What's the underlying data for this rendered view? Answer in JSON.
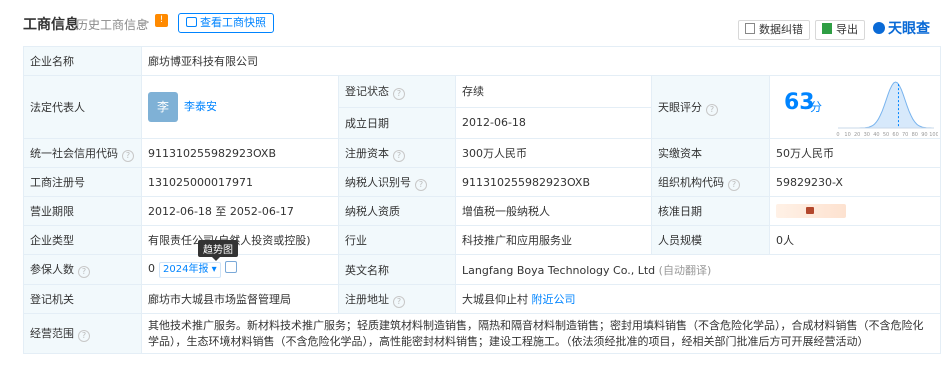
{
  "header": {
    "title": "工商信息",
    "history_link": "历史工商信息",
    "history_arrow": ">",
    "snapshot_button": "查看工商快照",
    "error_button": "数据纠错",
    "export_button": "导出",
    "logo_text": "天眼查"
  },
  "rows": {
    "company_name_label": "企业名称",
    "company_name": "廊坊博亚科技有限公司",
    "legal_rep_label": "法定代表人",
    "legal_rep_avatar": "李",
    "legal_rep_name": "李泰安",
    "reg_status_label": "登记状态",
    "reg_status": "存续",
    "found_date_label": "成立日期",
    "found_date": "2012-06-18",
    "score_label": "天眼评分",
    "score_value": "63",
    "score_unit": "分",
    "credit_code_label": "统一社会信用代码",
    "credit_code": "911310255982923OXB",
    "reg_capital_label": "注册资本",
    "reg_capital": "300万人民币",
    "paid_capital_label": "实缴资本",
    "paid_capital": "50万人民币",
    "reg_no_label": "工商注册号",
    "reg_no": "131025000017971",
    "taxpayer_id_label": "纳税人识别号",
    "taxpayer_id": "911310255982923OXB",
    "org_code_label": "组织机构代码",
    "org_code": "59829230-X",
    "term_label": "营业期限",
    "term": "2012-06-18 至 2052-06-17",
    "tax_qual_label": "纳税人资质",
    "tax_qual": "增值税一般纳税人",
    "approve_date_label": "核准日期",
    "type_label": "企业类型",
    "type_value": "有限责任公司(自然人投资或控股)",
    "industry_label": "行业",
    "industry": "科技推广和应用服务业",
    "staff_size_label": "人员规模",
    "staff_size": "0人",
    "insured_label": "参保人数",
    "insured_count": "0",
    "insured_year": "2024年报",
    "insured_tooltip": "趋势图",
    "english_name_label": "英文名称",
    "english_name": "Langfang Boya Technology Co., Ltd",
    "english_name_note": "(自动翻译)",
    "authority_label": "登记机关",
    "authority": "廊坊市大城县市场监督管理局",
    "address_label": "注册地址",
    "address": "大城县仰止村",
    "nearby_link": "附近公司",
    "scope_label": "经营范围",
    "scope": "其他技术推广服务。新材料技术推广服务；轻质建筑材料制造销售，隔热和隔音材料制造销售；密封用填料销售（不含危险化学品），合成材料销售（不含危险化学品），生态环境材料销售（不含危险化学品），高性能密封材料销售；建设工程施工。（依法须经批准的项目，经相关部门批准后方可开展经营活动）"
  },
  "score_chart": {
    "x_ticks": [
      "0",
      "10",
      "20",
      "30",
      "40",
      "50",
      "60",
      "70",
      "80",
      "90",
      "100"
    ],
    "highlight": 63
  },
  "colors": {
    "accent": "#0084ff",
    "label_bg": "#f2f9fc",
    "status_green": "#1aa34a",
    "border": "#e4eef6"
  },
  "icons": {
    "snapshot": "camera-icon",
    "error": "flag-icon",
    "export": "excel-icon",
    "help": "question-circle-icon",
    "lock": "lock-icon",
    "trend": "trend-chart-icon"
  }
}
